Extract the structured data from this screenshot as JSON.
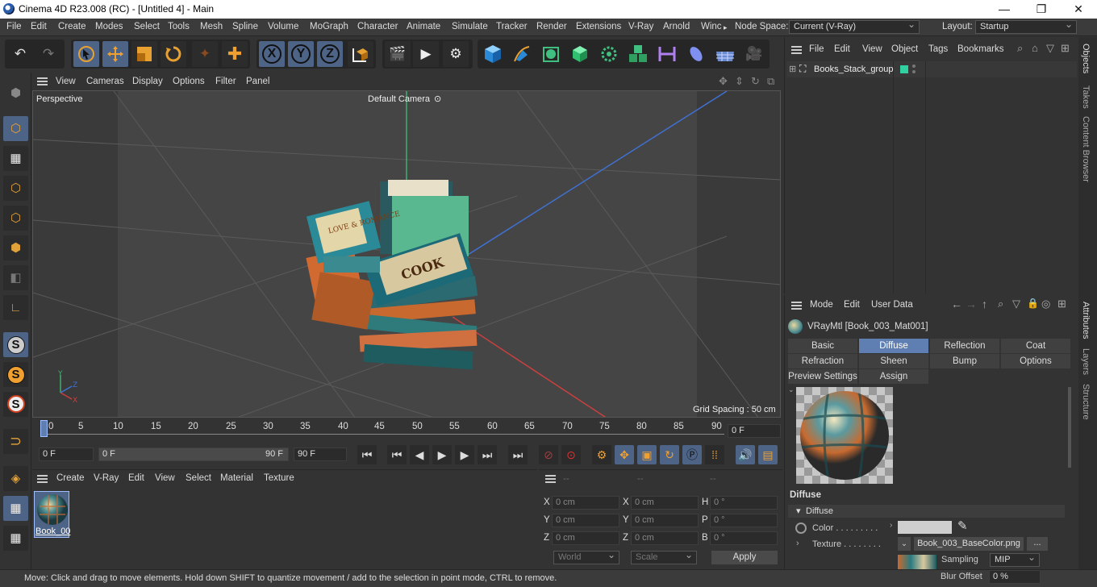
{
  "titlebar": {
    "title": "Cinema 4D R23.008 (RC) - [Untitled 4] - Main",
    "minimize": "—",
    "maximize": "❐",
    "close": "✕"
  },
  "menu": {
    "items": [
      "File",
      "Edit",
      "Create",
      "Modes",
      "Select",
      "Tools",
      "Mesh",
      "Spline",
      "Volume",
      "MoGraph",
      "Character",
      "Animate",
      "Simulate",
      "Tracker",
      "Render",
      "Extensions",
      "V-Ray",
      "Arnold",
      "Winc"
    ],
    "more": "▸",
    "node_space_label": "Node Space:",
    "node_space_value": "Current (V-Ray)",
    "layout_label": "Layout:",
    "layout_value": "Startup"
  },
  "toolbar": {
    "undo": "↶",
    "redo": "↷",
    "x": "X",
    "y": "Y",
    "z": "Z"
  },
  "viewport": {
    "menu": [
      "View",
      "Cameras",
      "Display",
      "Options",
      "Filter",
      "Panel"
    ],
    "projection": "Perspective",
    "camera": "Default Camera",
    "camera_icon": "⊙",
    "grid_spacing": "Grid Spacing : 50 cm",
    "book1_title": "LOVE & ROMANCE",
    "book2_title": "COOK"
  },
  "timeline": {
    "ticks": [
      "0",
      "5",
      "10",
      "15",
      "20",
      "25",
      "30",
      "35",
      "40",
      "45",
      "50",
      "55",
      "60",
      "65",
      "70",
      "75",
      "80",
      "85",
      "90"
    ],
    "current_frame": "0 F"
  },
  "playbar": {
    "start": "0 F",
    "range_start": "0 F",
    "range_end": "90 F",
    "end": "90 F"
  },
  "material_manager": {
    "menu": [
      "Create",
      "V-Ray",
      "Edit",
      "View",
      "Select",
      "Material",
      "Texture"
    ],
    "material_name": "Book_00"
  },
  "coords": {
    "headers": [
      "--",
      "--",
      "--"
    ],
    "rows": [
      {
        "l1": "X",
        "v1": "0 cm",
        "l2": "X",
        "v2": "0 cm",
        "l3": "H",
        "v3": "0 °"
      },
      {
        "l1": "Y",
        "v1": "0 cm",
        "l2": "Y",
        "v2": "0 cm",
        "l3": "P",
        "v3": "0 °"
      },
      {
        "l1": "Z",
        "v1": "0 cm",
        "l2": "Z",
        "v2": "0 cm",
        "l3": "B",
        "v3": "0 °"
      }
    ],
    "world": "World",
    "scale": "Scale",
    "apply": "Apply"
  },
  "objects": {
    "menu": [
      "File",
      "Edit",
      "View",
      "Object",
      "Tags",
      "Bookmarks"
    ],
    "item": "Books_Stack_group"
  },
  "attributes": {
    "menu": [
      "Mode",
      "Edit",
      "User Data"
    ],
    "material_title": "VRayMtl [Book_003_Mat001]",
    "tabs_row1": [
      "Basic",
      "Diffuse",
      "Reflection",
      "Coat"
    ],
    "tabs_row2": [
      "Refraction",
      "Sheen",
      "Bump",
      "Options"
    ],
    "tabs_row3": [
      "Preview Settings",
      "Assign"
    ],
    "section": "Diffuse",
    "subsection": "Diffuse",
    "color_label": "Color . . . . . . . . .",
    "texture_label": "Texture . . . . . . . .",
    "texture_file": "Book_003_BaseColor.png",
    "texture_more": "...",
    "sampling_label": "Sampling",
    "sampling_value": "MIP",
    "blur_label": "Blur Offset",
    "blur_value": "0 %"
  },
  "sidetabs": [
    "Objects",
    "Takes",
    "Content Browser",
    "Attributes",
    "Layers",
    "Structure"
  ],
  "status": {
    "text": "Move: Click and drag to move elements. Hold down SHIFT to quantize movement / add to the selection in point mode, CTRL to remove."
  },
  "colors": {
    "accent": "#5f7fb3",
    "highlight": "#4d6487",
    "x_axis": "#c84040",
    "y_axis": "#40b070",
    "z_axis": "#4070d0"
  }
}
